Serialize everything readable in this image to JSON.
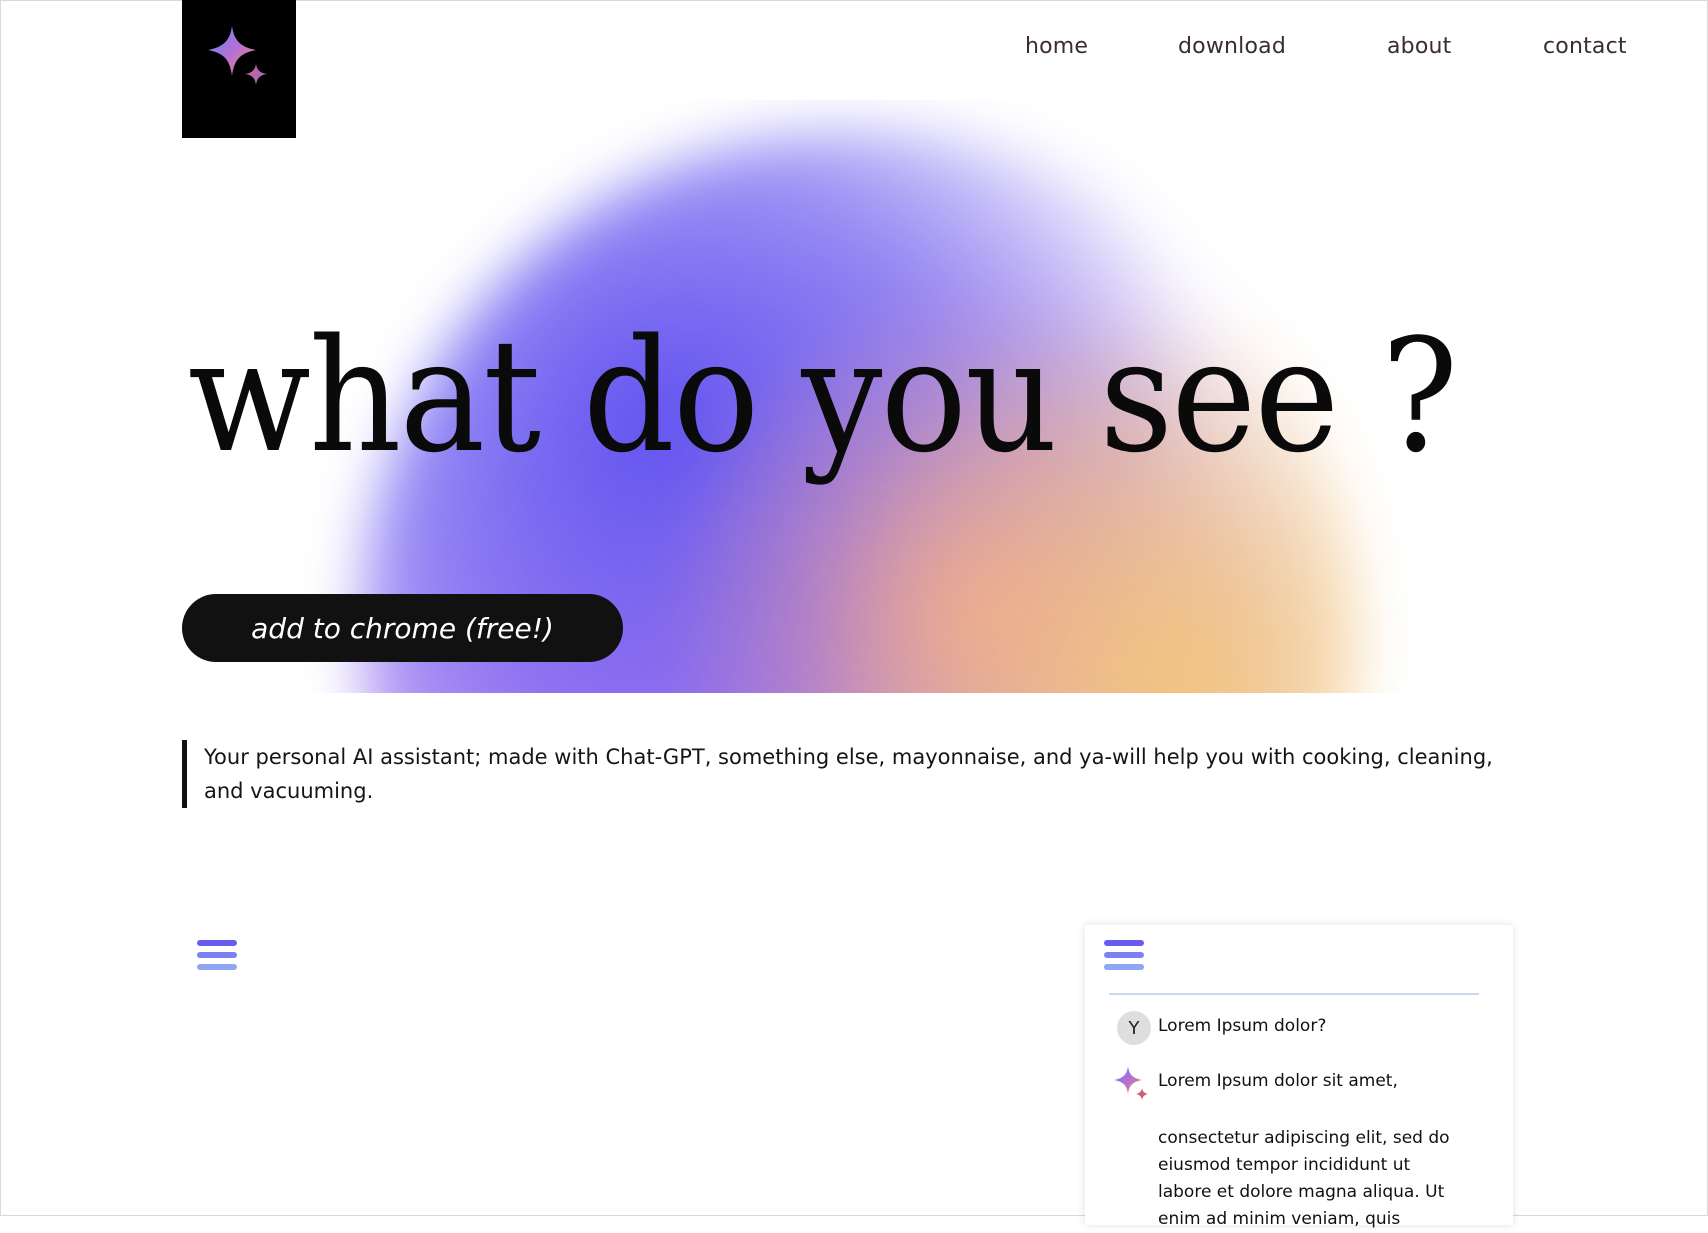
{
  "nav": {
    "home": "home",
    "download": "download",
    "about": "about",
    "contact": "contact"
  },
  "hero": {
    "headline": "what do you see ?",
    "cta_label": "add to chrome (free!)",
    "tagline": "Your personal AI assistant; made with Chat-GPT, something else, mayonnaise, and ya-will help you with cooking, cleaning, and vacuuming."
  },
  "chat": {
    "user_avatar": "Y",
    "user_message": "Lorem Ipsum dolor?",
    "bot_message": "Lorem Ipsum dolor sit amet,",
    "bot_continuation": "consectetur adipiscing elit, sed do eiusmod tempor incididunt ut labore et dolore magna aliqua. Ut enim ad minim veniam, quis"
  },
  "icons": {
    "logo": "sparkle-icon",
    "menu": "hamburger-menu-icon",
    "assistant": "sparkle-icon"
  },
  "colors": {
    "logo_bg": "#000000",
    "cta_bg": "#111111",
    "menu_bar_1": "#6b5cf0",
    "menu_bar_2": "#7b82f0",
    "menu_bar_3": "#8fa6f4",
    "blob_purple": "#6254f0",
    "blob_peach": "#f4c478",
    "blob_pink": "#eea096"
  }
}
